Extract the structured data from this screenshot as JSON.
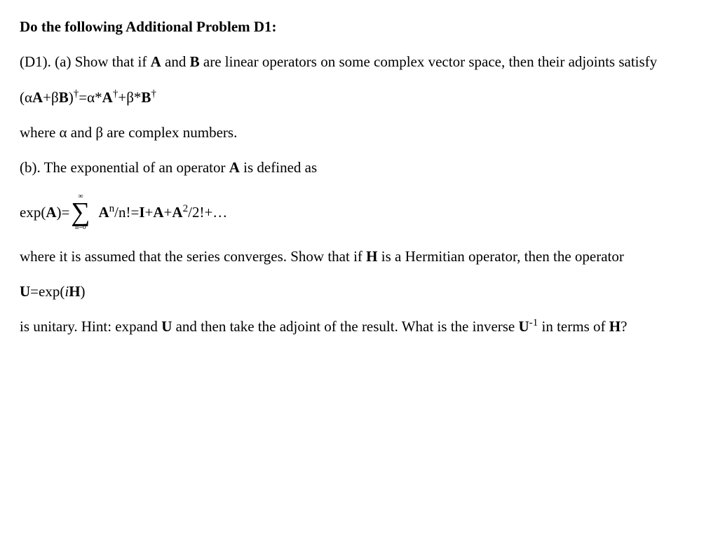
{
  "heading": "Do the following Additional Problem D1:",
  "partA": {
    "d1": "(D1). (a) Show that if ",
    "A": "A",
    "and": " and ",
    "B": "B",
    "rest": " are linear operators on some complex vector space, then their adjoints satisfy"
  },
  "eqA_left_open": "(α",
  "eqA_A": "A",
  "eqA_plus": "+β",
  "eqA_B": "B",
  "eqA_close": ")",
  "eqA_dag": "†",
  "eqA_eq": "=α*",
  "eqA_A2": "A",
  "eqA_dag2": "†",
  "eqA_plus2": "+β*",
  "eqA_B2": "B",
  "eqA_dag3": "†",
  "whereAB": "where α and β are complex numbers.",
  "partB": {
    "lead": "(b). The exponential of an operator ",
    "A": "A",
    "rest": " is defined as"
  },
  "sum": {
    "expA": "exp(",
    "A": "A",
    "closeEq": ")= ",
    "top": "∞",
    "bottom": "n=0",
    "An": "A",
    "nExp": "n",
    "slashFact": "/n!=",
    "I": "I",
    "plus": "+",
    "A2": "A",
    "plus2": "+",
    "A3": "A",
    "twoExp": "2",
    "slash2fact": "/2!+…"
  },
  "herm": {
    "lead": "where it is assumed that the series converges. Show that if ",
    "H": "H",
    "rest": " is a Hermitian operator, then the operator"
  },
  "Ueq": {
    "U": "U",
    "eq": "=exp(",
    "i": "i",
    "H": "H",
    "close": ")"
  },
  "hint": {
    "lead": "is unitary. Hint: expand ",
    "U": "U",
    "mid": " and then take the adjoint of the result. What is the inverse ",
    "U2": "U",
    "neg1": "-1",
    "rest": " in terms of ",
    "H": "H",
    "q": "?"
  }
}
